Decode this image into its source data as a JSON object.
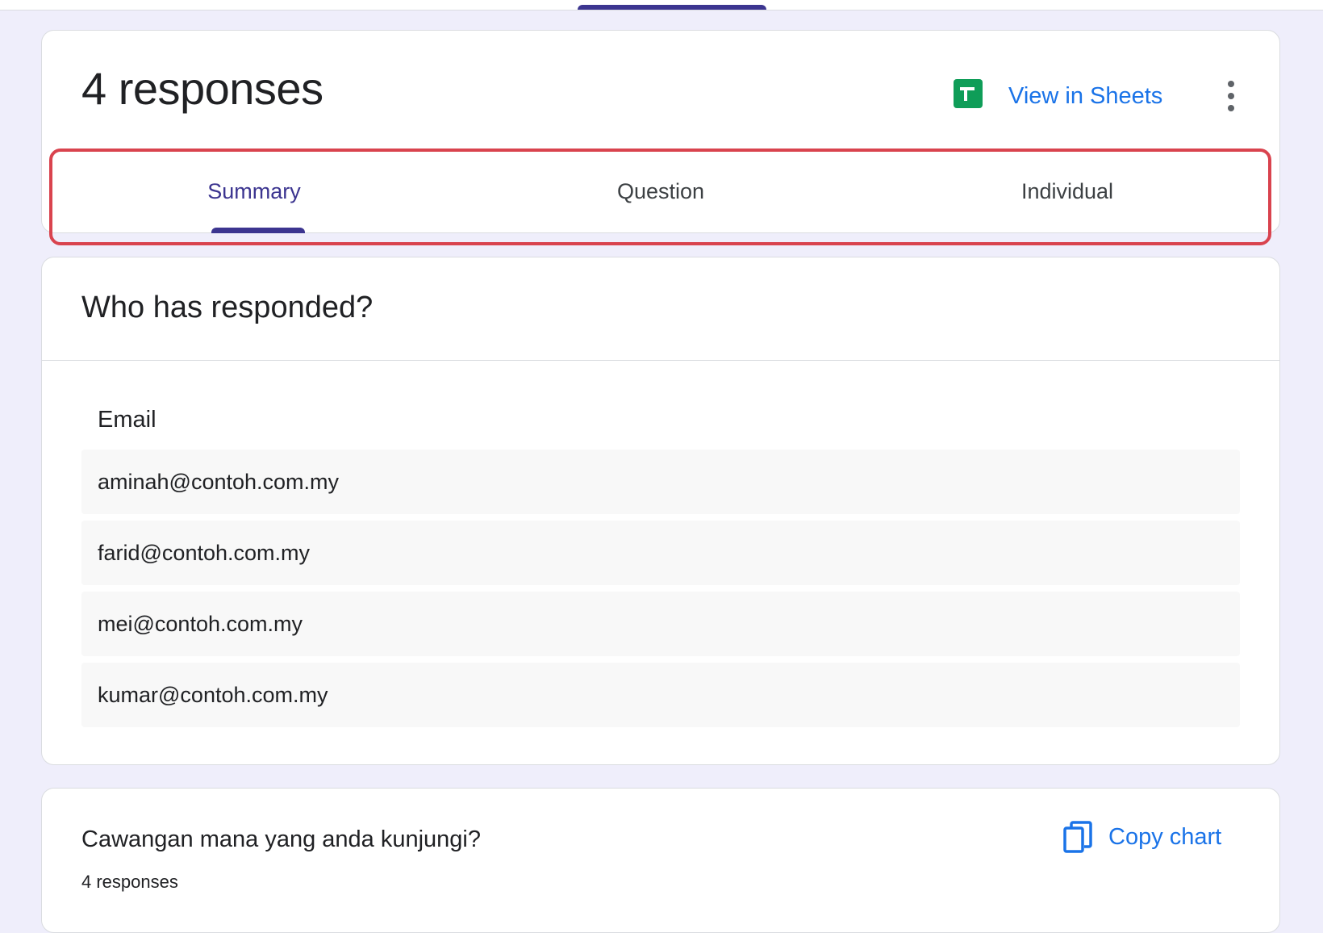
{
  "header": {
    "title": "4 responses",
    "sheets_link": "View in Sheets",
    "colors": {
      "sheets_green": "#0f9d58",
      "link_blue": "#1a73e8",
      "accent": "#3c3590"
    }
  },
  "tabs": [
    {
      "label": "Summary",
      "active": true
    },
    {
      "label": "Question",
      "active": false
    },
    {
      "label": "Individual",
      "active": false
    }
  ],
  "who": {
    "title": "Who has responded?",
    "column_label": "Email",
    "emails": [
      "aminah@contoh.com.my",
      "farid@contoh.com.my",
      "mei@contoh.com.my",
      "kumar@contoh.com.my"
    ]
  },
  "chart_card": {
    "question": "Cawangan mana yang anda kunjungi?",
    "count": "4 responses",
    "copy_label": "Copy chart"
  }
}
